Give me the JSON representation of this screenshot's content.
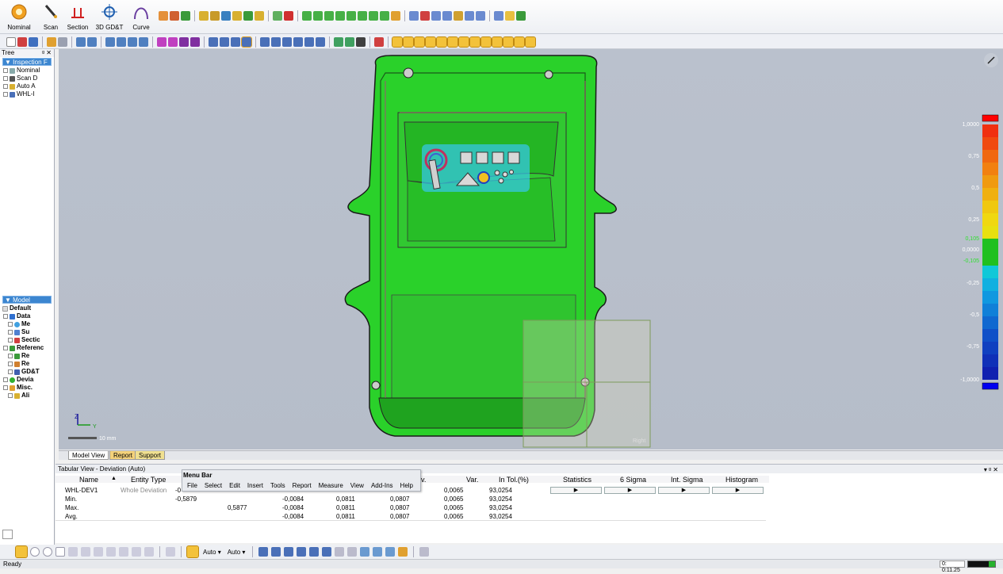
{
  "ribbon": {
    "buttons": [
      "Nominal",
      "Scan",
      "Section",
      "3D GD&T",
      "Curve"
    ]
  },
  "tree": {
    "title": "Tree",
    "controls": "ᵍ ✕",
    "inspection_header": "Inspection F",
    "items": [
      "Nominal",
      "Scan D",
      "Auto A",
      "WHL-I"
    ]
  },
  "model": {
    "header": "Model",
    "default": "Default",
    "items": [
      "Data",
      "Me",
      "Su",
      "Sectic",
      "Referenc",
      "Re",
      "Re",
      "GD&T",
      "Devia",
      "Misc.",
      "Ali"
    ]
  },
  "viewport": {
    "scale_label": "10 mm",
    "axis_z": "Z",
    "axis_y": "Y",
    "view_label": "Right",
    "color_scale": {
      "max": "1,0000",
      "l075": "0,75",
      "l05": "0,5",
      "l025": "0,25",
      "tol_plus": "0,105",
      "zero": "0,0000",
      "tol_minus": "-0,105",
      "ln025": "-0,25",
      "ln05": "-0,5",
      "ln075": "-0,75",
      "min": "-1,0000"
    }
  },
  "tabs": {
    "model_view": "Model View",
    "report": "Report",
    "support": "Support"
  },
  "tabular": {
    "title": "Tabular View - Deviation (Auto)",
    "columns": {
      "name": "Name",
      "entity_type": "Entity Type",
      "stdev_partial": "v.",
      "var": "Var.",
      "in_tol": "In Tol.(%)",
      "statistics": "Statistics",
      "six_sigma": "6 Sigma",
      "int_sigma": "Int. Sigma",
      "histogram": "Histogram"
    },
    "rows": [
      {
        "name": "WHL-DEV1",
        "type": "Whole Deviation",
        "c3": "-0",
        "c4": "",
        "avg": "",
        "rms": "",
        "sd": "",
        "var": "0,0065",
        "intol": "93,0254"
      },
      {
        "name": "Min.",
        "type": "",
        "c3": "-0,5879",
        "c4": "",
        "avg": "-0,0084",
        "rms": "0,0811",
        "sd": "0,0807",
        "var": "0,0065",
        "intol": "93,0254"
      },
      {
        "name": "Max.",
        "type": "",
        "c3": "",
        "c4": "0,5877",
        "avg": "-0,0084",
        "rms": "0,0811",
        "sd": "0,0807",
        "var": "0,0065",
        "intol": "93,0254"
      },
      {
        "name": "Avg.",
        "type": "",
        "c3": "",
        "c4": "",
        "avg": "-0,0084",
        "rms": "0,0811",
        "sd": "0,0807",
        "var": "0,0065",
        "intol": "93,0254"
      }
    ],
    "play": "▶"
  },
  "menu_tip": {
    "title": "Menu Bar",
    "items": [
      "File",
      "Select",
      "Edit",
      "Insert",
      "Tools",
      "Report",
      "Measure",
      "View",
      "Add-Ins",
      "Help"
    ]
  },
  "bottom": {
    "auto1": "Auto",
    "auto2": "Auto"
  },
  "status": {
    "text": "Ready",
    "timer": "0: 0:11.25"
  },
  "colors": {
    "part_green": "#2ad12a",
    "viewport_bg": "#b8bfcb",
    "accent_blue": "#3c86d0"
  }
}
